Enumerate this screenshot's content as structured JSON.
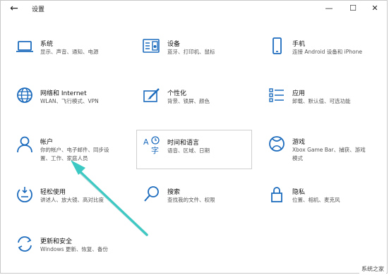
{
  "window": {
    "title": "设置",
    "back_glyph": "←",
    "minimize_glyph": "—",
    "maximize_glyph": "☐",
    "close_glyph": "✕"
  },
  "tiles": [
    {
      "name": "系统",
      "desc": [
        "显示、声音、通知、电源"
      ],
      "icon": "laptop-icon"
    },
    {
      "name": "设备",
      "desc": [
        "蓝牙、打印机、鼠标"
      ],
      "icon": "keyboard-speaker-icon"
    },
    {
      "name": "手机",
      "desc": [
        "连接 Android 设备和 iPhone"
      ],
      "icon": "phone-icon"
    },
    {
      "name": "网络和 Internet",
      "desc": [
        "WLAN、飞行模式、VPN"
      ],
      "icon": "globe-icon"
    },
    {
      "name": "个性化",
      "desc": [
        "背景、锁屏、颜色"
      ],
      "icon": "paintbrush-icon"
    },
    {
      "name": "应用",
      "desc": [
        "卸载、默认值、可选功能"
      ],
      "icon": "apps-list-icon"
    },
    {
      "name": "帐户",
      "desc": [
        "你的帐户、电子邮件、同步设",
        "置、工作、家庭人员"
      ],
      "icon": "person-icon"
    },
    {
      "name": "时间和语言",
      "desc": [
        "语音、区域、日期"
      ],
      "icon": "time-language-icon"
    },
    {
      "name": "游戏",
      "desc": [
        "Xbox Game Bar、捕获、游戏",
        "模式"
      ],
      "icon": "xbox-icon"
    },
    {
      "name": "轻松使用",
      "desc": [
        "讲述人、放大镜、高对比度"
      ],
      "icon": "ease-of-access-icon"
    },
    {
      "name": "搜索",
      "desc": [
        "查找我的文件、权限"
      ],
      "icon": "search-icon"
    },
    {
      "name": "隐私",
      "desc": [
        "位置、相机、麦克风"
      ],
      "icon": "lock-icon"
    },
    {
      "name": "更新和安全",
      "desc": [
        "Windows 更新、恢复、备份"
      ],
      "icon": "sync-icon"
    }
  ],
  "colors": {
    "accent": "#1c6bbd",
    "arrow": "#3cc9c4"
  },
  "watermark": "系统之家"
}
